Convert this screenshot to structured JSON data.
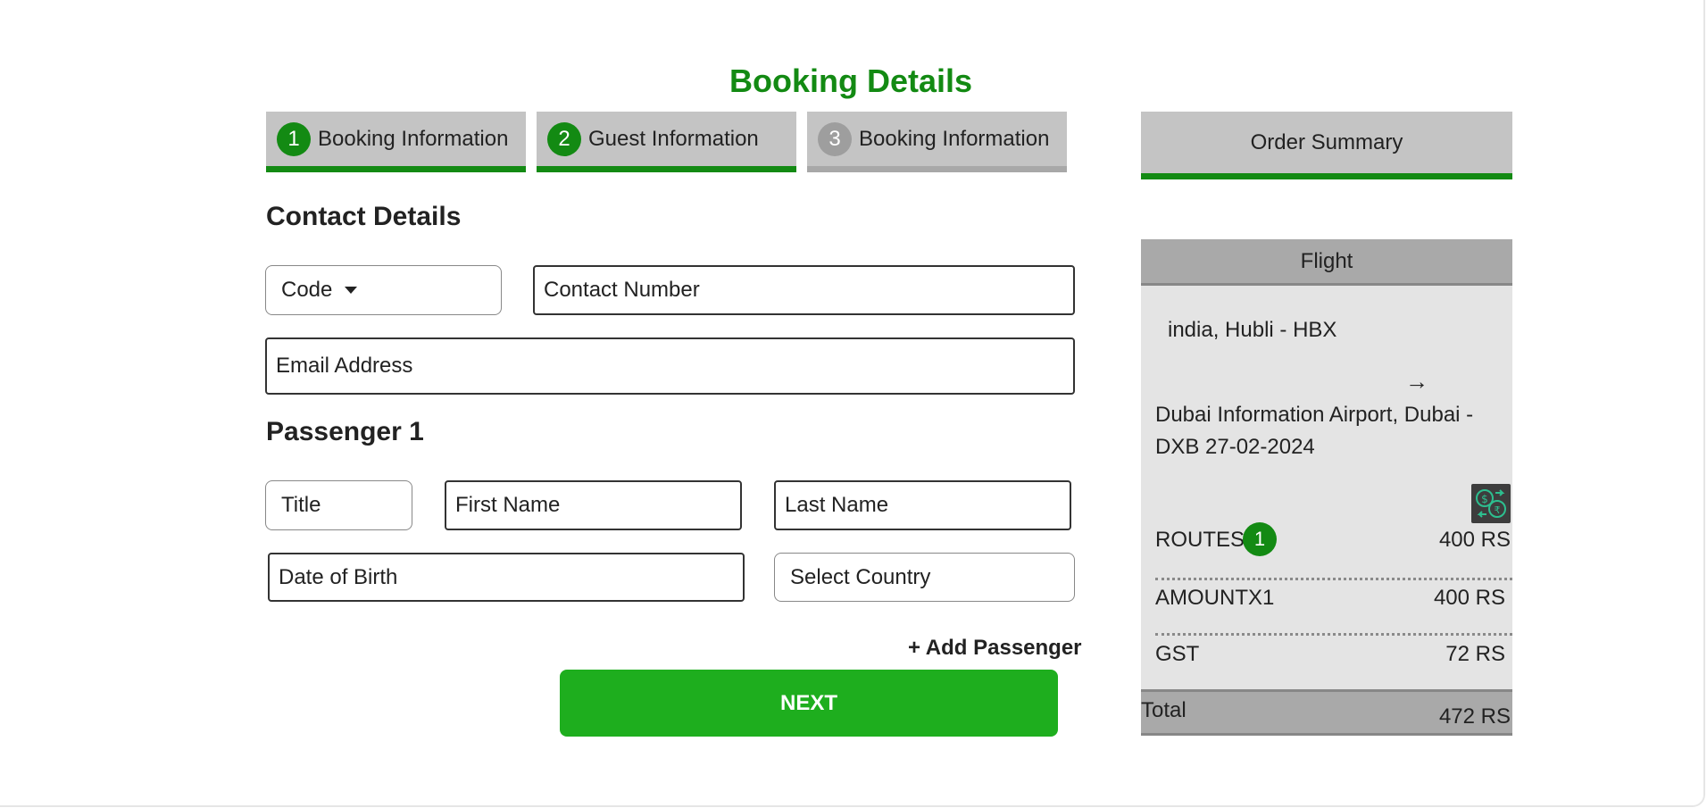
{
  "page_title": "Booking Details",
  "steps": [
    {
      "num": "1",
      "label": "Booking Information"
    },
    {
      "num": "2",
      "label": "Guest Information"
    },
    {
      "num": "3",
      "label": "Booking Information"
    }
  ],
  "contact": {
    "section_title": "Contact Details",
    "code_label": "Code",
    "contact_number_placeholder": "Contact Number",
    "email_placeholder": "Email Address"
  },
  "passenger": {
    "section_title": "Passenger 1",
    "title_placeholder": "Title",
    "first_name_placeholder": "First Name",
    "last_name_placeholder": "Last Name",
    "dob_placeholder": "Date of Birth",
    "country_placeholder": "Select Country"
  },
  "add_passenger_label": "+ Add Passenger",
  "next_label": "NEXT",
  "summary": {
    "tab_label": "Order Summary",
    "flight_label": "Flight",
    "origin": "india, Hubli - HBX",
    "arrow": "→",
    "destination_line1": "Dubai Information Airport, Dubai -",
    "destination_line2": "DXB 27-02-2024",
    "routes_label": "ROUTES",
    "routes_count": "1",
    "routes_value": "400 RS",
    "amount_label": "AMOUNTX1",
    "amount_value": "400 RS",
    "gst_label": "GST",
    "gst_value": "72 RS",
    "total_label": "Total",
    "total_value": "472 RS"
  },
  "colors": {
    "accent_green": "#138a13",
    "button_green": "#1eae1e",
    "tab_gray": "#c4c4c4",
    "inactive_gray": "#9e9e9e"
  },
  "icons": {
    "currency_exchange": "currency-exchange-icon",
    "code_dropdown": "chevron-down-icon",
    "route_arrow": "arrow-right-icon"
  }
}
